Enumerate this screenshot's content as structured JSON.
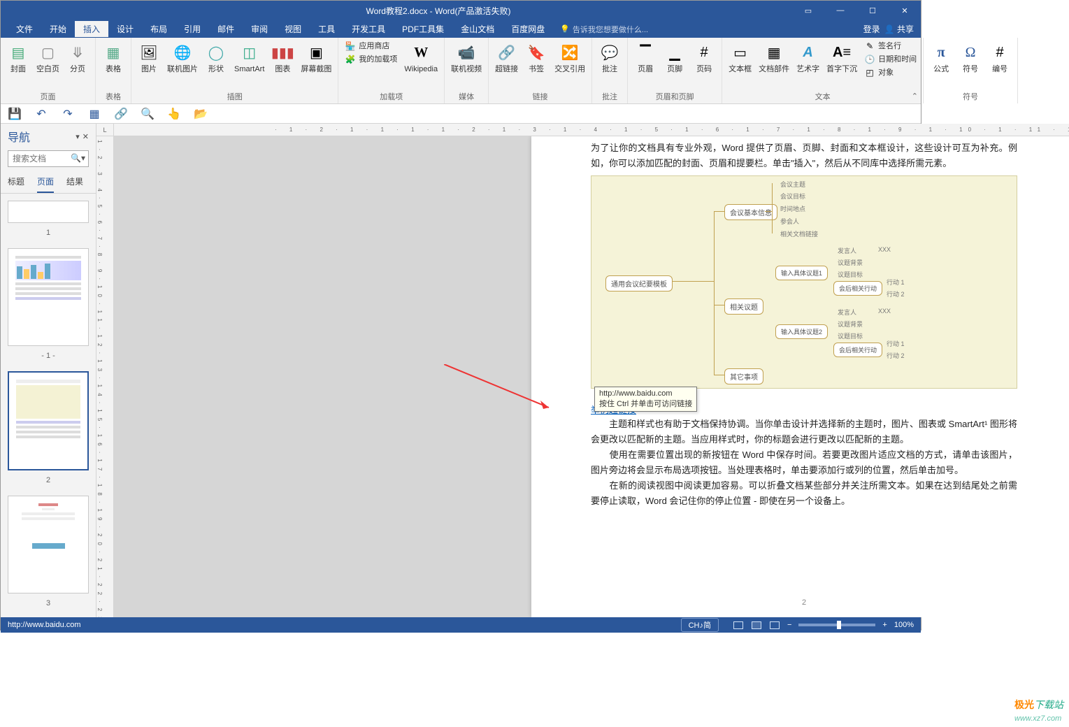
{
  "title": "Word教程2.docx - Word(产品激活失败)",
  "menus": {
    "file": "文件",
    "home": "开始",
    "insert": "插入",
    "design": "设计",
    "layout": "布局",
    "ref": "引用",
    "mail": "邮件",
    "review": "审阅",
    "view": "视图",
    "tools": "工具",
    "dev": "开发工具",
    "pdf": "PDF工具集",
    "jinshan": "金山文档",
    "baidu": "百度网盘"
  },
  "tell_me": "告诉我您想要做什么...",
  "login": "登录",
  "share": "共享",
  "ribbon": {
    "pages": {
      "cover": "封面",
      "blank": "空白页",
      "break": "分页",
      "label": "页面"
    },
    "tables": {
      "table": "表格",
      "label": "表格"
    },
    "illus": {
      "pic": "图片",
      "online_pic": "联机图片",
      "shapes": "形状",
      "smartart": "SmartArt",
      "chart": "图表",
      "screenshot": "屏幕截图",
      "label": "插图"
    },
    "addins": {
      "store": "应用商店",
      "myaddins": "我的加载项",
      "wiki": "Wikipedia",
      "label": "加载项"
    },
    "media": {
      "video": "联机视频",
      "label": "媒体"
    },
    "links": {
      "hyper": "超链接",
      "bookmark": "书签",
      "crossref": "交叉引用",
      "label": "链接"
    },
    "comments": {
      "comment": "批注",
      "label": "批注"
    },
    "hf": {
      "header": "页眉",
      "footer": "页脚",
      "pagenum": "页码",
      "label": "页眉和页脚"
    },
    "text": {
      "textbox": "文本框",
      "parts": "文档部件",
      "wordart": "艺术字",
      "dropcap": "首字下沉",
      "sig": "签名行",
      "dt": "日期和时间",
      "obj": "对象",
      "label": "文本"
    },
    "symbols": {
      "eq": "公式",
      "sym": "符号",
      "num": "编号",
      "label": "符号"
    }
  },
  "nav": {
    "title": "导航",
    "search_ph": "搜索文档",
    "tabs": {
      "headings": "标题",
      "pages": "页面",
      "results": "结果"
    },
    "pagelabels": [
      "1",
      "- 1 -",
      "2",
      "3"
    ]
  },
  "doc": {
    "p1": "为了让你的文档具有专业外观，Word 提供了页眉、页脚、封面和文本框设计，这些设计可互为补充。例如，你可以添加匹配的封面、页眉和提要栏。单击\"插入\"，然后从不同库中选择所需元素。",
    "link": "举例超链接",
    "tooltip_url": "http://www.baidu.com",
    "tooltip_hint": "按住 Ctrl 并单击可访问链接",
    "p2": "主题和样式也有助于文档保持协调。当你单击设计并选择新的主题时，图片、图表或 SmartArt¹ 图形将会更改以匹配新的主题。当应用样式时，你的标题会进行更改以匹配新的主题。",
    "p3": "使用在需要位置出现的新按钮在 Word 中保存时间。若要更改图片适应文档的方式，请单击该图片，图片旁边将会显示布局选项按钮。当处理表格时，单击要添加行或列的位置，然后单击加号。",
    "p4": "在新的阅读视图中阅读更加容易。可以折叠文档某些部分并关注所需文本。如果在达到结尾处之前需要停止读取，Word 会记住你的停止位置 - 即使在另一个设备上。",
    "pagenum": "2",
    "diagram": {
      "root": "通用会议纪要模板",
      "n1": "会议基本信息",
      "n2": "相关议题",
      "n3": "其它事项",
      "a1": "会议主题",
      "a2": "会议目标",
      "a3": "时间地点",
      "a4": "参会人",
      "a5": "相关文档链接",
      "b1": "输入具体议题1",
      "b2": "输入具体议题2",
      "c1": "发言人",
      "c2": "议题背景",
      "c3": "议题目标",
      "c4": "会后相关行动",
      "d1": "行动 1",
      "d2": "行动 2",
      "xxx": "XXX"
    }
  },
  "status": {
    "url": "http://www.baidu.com",
    "ime": "CH♪简",
    "zoom": "100%"
  },
  "watermark": {
    "a": "极光",
    "b": "下载站",
    "c": "www.xz7.com"
  }
}
